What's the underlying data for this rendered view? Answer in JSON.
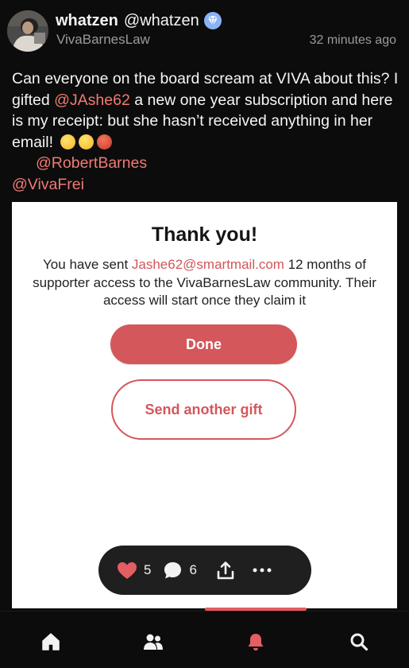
{
  "post": {
    "display_name": "whatzen",
    "handle": "@whatzen",
    "community": "VivaBarnesLaw",
    "timestamp": "32 minutes ago",
    "text_1": "Can everyone on the board scream at VIVA about this?  I gifted ",
    "mention_1": "@JAshe62",
    "text_2": " a new one year subscription and here is my receipt: but she hasn’t received anything in her email! ",
    "mention_2": "@RobertBarnes",
    "mention_3": "@VivaFrei",
    "emojis": [
      "face-with-raised-eyebrow",
      "face-with-monocle",
      "face-with-symbols-on-mouth"
    ]
  },
  "receipt": {
    "title": "Thank you!",
    "body_1": "You have sent ",
    "email": "Jashe62@smartmail.com",
    "body_2": " 12 months of supporter access to the VivaBarnesLaw community. Their access will start once they claim it",
    "done_label": "Done",
    "another_label": "Send another gift"
  },
  "actions": {
    "likes": "5",
    "comments": "6"
  },
  "nav": {
    "items": [
      "home-icon",
      "people-icon",
      "bell-icon",
      "search-icon"
    ],
    "active": "bell-icon"
  },
  "colors": {
    "accent": "#f07a74",
    "brand_red": "#d3575b",
    "background": "#0c0c0c",
    "verified": "#8ab3f5"
  }
}
